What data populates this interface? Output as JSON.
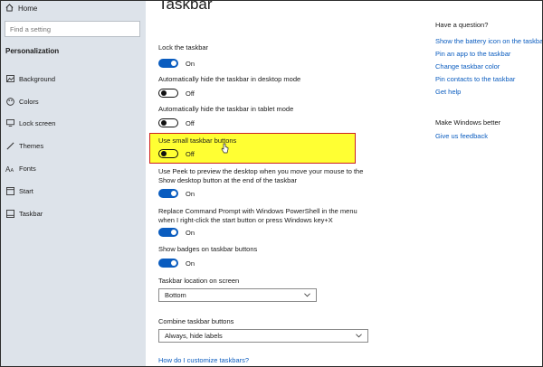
{
  "sidebar": {
    "home_label": "Home",
    "search_placeholder": "Find a setting",
    "section_title": "Personalization",
    "items": [
      {
        "label": "Background",
        "icon": "picture-icon"
      },
      {
        "label": "Colors",
        "icon": "palette-icon"
      },
      {
        "label": "Lock screen",
        "icon": "monitor-icon"
      },
      {
        "label": "Themes",
        "icon": "brush-icon"
      },
      {
        "label": "Fonts",
        "icon": "font-icon"
      },
      {
        "label": "Start",
        "icon": "start-icon"
      },
      {
        "label": "Taskbar",
        "icon": "taskbar-icon"
      }
    ],
    "active_item": "Taskbar"
  },
  "main": {
    "title": "Taskbar",
    "settings": [
      {
        "label": "Lock the taskbar",
        "state": "On"
      },
      {
        "label": "Automatically hide the taskbar in desktop mode",
        "state": "Off"
      },
      {
        "label": "Automatically hide the taskbar in tablet mode",
        "state": "Off"
      },
      {
        "label": "Use small taskbar buttons",
        "state": "Off"
      },
      {
        "label_line1": "Use Peek to preview the desktop when you move your mouse to the",
        "label_line2": "Show desktop button at the end of the taskbar",
        "state": "On"
      },
      {
        "label_line1": "Replace Command Prompt with Windows PowerShell in the menu",
        "label_line2": "when I right-click the start button or press Windows key+X",
        "state": "On"
      },
      {
        "label": "Show badges on taskbar buttons",
        "state": "On"
      }
    ],
    "location_label": "Taskbar location on screen",
    "location_value": "Bottom",
    "combine_label": "Combine taskbar buttons",
    "combine_value": "Always, hide labels",
    "customize_link": "How do I customize taskbars?"
  },
  "right": {
    "question_heading": "Have a question?",
    "question_links": [
      "Show the battery icon on the taskbar",
      "Pin an app to the taskbar",
      "Change taskbar color",
      "Pin contacts to the taskbar",
      "Get help"
    ],
    "better_heading": "Make Windows better",
    "feedback_link": "Give us feedback"
  },
  "colors": {
    "accent": "#0a5cbf",
    "sidebar_bg": "#dde3ea",
    "highlight": "#ffff33",
    "highlight_border": "#cc2222"
  }
}
